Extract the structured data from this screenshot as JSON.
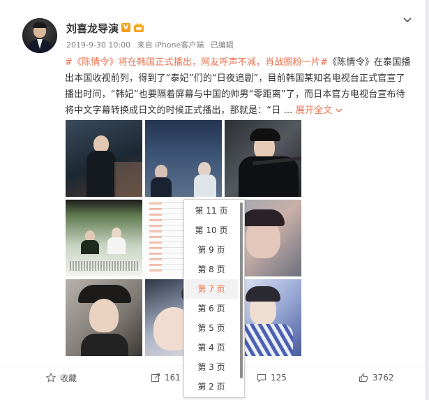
{
  "post": {
    "author": "刘喜龙导演",
    "verified_badge": "V",
    "date": "2019-9-30 10:00",
    "source": "来自 iPhone客户端",
    "edited": "已编辑",
    "text_topic": "#《陈情令》将在韩国正式播出，网友呼声不减，肖战圈粉一片#",
    "text_body": "《陈情令》在泰国播出本国收视前列，得到了“泰妃”们的“日夜追剧”，目前韩国某知名电视台正式官宣了播出时间，“韩妃”也要隔着屏幕与中国的帅男“零距离”了，而日本官方电视台宣布待将中文字幕转换成日文的时候正式播出，那就是：“日 ...",
    "expand_label": "展开全文"
  },
  "actions": {
    "favorite_label": "收藏",
    "repost_count": "161",
    "comment_count": "125",
    "like_count": "3762"
  },
  "page_dropdown": {
    "options": [
      "第 11 页",
      "第 10 页",
      "第 9 页",
      "第 8 页",
      "第 7 页",
      "第 6 页",
      "第 5 页",
      "第 4 页",
      "第 3 页",
      "第 2 页"
    ],
    "selected": "第 7 页"
  },
  "icons": {
    "author_badge": "verified-v-icon",
    "level_badge": "level-badge-icon",
    "menu": "chevron-down-icon",
    "favorite": "star-icon",
    "repost": "share-icon",
    "comment": "comment-icon",
    "like": "thumbs-up-icon"
  },
  "colors": {
    "accent": "#eb7350",
    "verified": "#f0a020",
    "text": "#333333",
    "meta": "#808080"
  }
}
